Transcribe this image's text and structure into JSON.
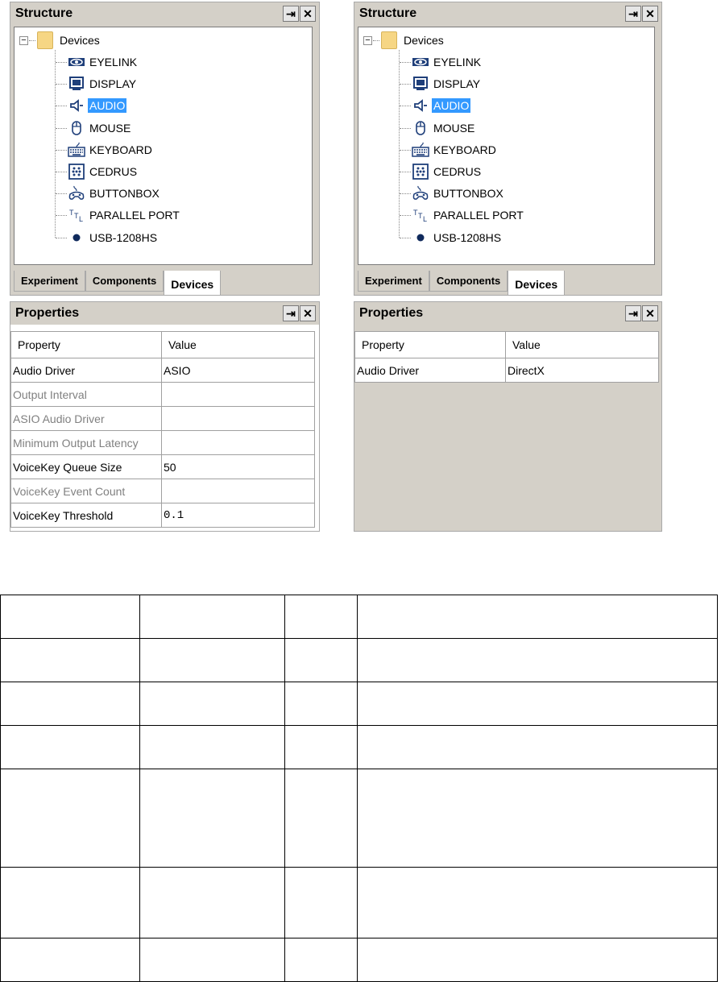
{
  "left": {
    "structure": {
      "title": "Structure",
      "root_label": "Devices",
      "items": [
        {
          "label": "EYELINK",
          "icon": "eyelink-icon"
        },
        {
          "label": "DISPLAY",
          "icon": "display-icon"
        },
        {
          "label": "AUDIO",
          "icon": "audio-icon",
          "selected": true
        },
        {
          "label": "MOUSE",
          "icon": "mouse-icon"
        },
        {
          "label": "KEYBOARD",
          "icon": "keyboard-icon"
        },
        {
          "label": "CEDRUS",
          "icon": "cedrus-icon"
        },
        {
          "label": "BUTTONBOX",
          "icon": "buttonbox-icon"
        },
        {
          "label": "PARALLEL PORT",
          "icon": "ttl-icon"
        },
        {
          "label": "USB-1208HS",
          "icon": "usb-dot-icon"
        }
      ],
      "tabs": [
        "Experiment",
        "Components",
        "Devices"
      ],
      "active_tab": "Devices"
    },
    "properties": {
      "title": "Properties",
      "header": {
        "property": "Property",
        "value": "Value"
      },
      "rows": [
        {
          "property": "Audio Driver",
          "value": "ASIO",
          "enabled": true
        },
        {
          "property": "Output Interval",
          "value": "",
          "enabled": false
        },
        {
          "property": "ASIO Audio Driver",
          "value": "",
          "enabled": false
        },
        {
          "property": "Minimum Output Latency",
          "value": "",
          "enabled": false
        },
        {
          "property": "VoiceKey Queue Size",
          "value": "50",
          "enabled": true
        },
        {
          "property": "VoiceKey Event Count",
          "value": "",
          "enabled": false
        },
        {
          "property": "VoiceKey Threshold",
          "value": "0.1",
          "enabled": true
        }
      ]
    }
  },
  "right": {
    "structure": {
      "title": "Structure",
      "root_label": "Devices",
      "items": [
        {
          "label": "EYELINK",
          "icon": "eyelink-icon"
        },
        {
          "label": "DISPLAY",
          "icon": "display-icon"
        },
        {
          "label": "AUDIO",
          "icon": "audio-icon",
          "selected": true
        },
        {
          "label": "MOUSE",
          "icon": "mouse-icon"
        },
        {
          "label": "KEYBOARD",
          "icon": "keyboard-icon"
        },
        {
          "label": "CEDRUS",
          "icon": "cedrus-icon"
        },
        {
          "label": "BUTTONBOX",
          "icon": "buttonbox-icon"
        },
        {
          "label": "PARALLEL PORT",
          "icon": "ttl-icon"
        },
        {
          "label": "USB-1208HS",
          "icon": "usb-dot-icon"
        }
      ],
      "tabs": [
        "Experiment",
        "Components",
        "Devices"
      ],
      "active_tab": "Devices"
    },
    "properties": {
      "title": "Properties",
      "header": {
        "property": "Property",
        "value": "Value"
      },
      "rows": [
        {
          "property": "Audio Driver",
          "value": "DirectX",
          "enabled": true
        }
      ]
    }
  },
  "pin_glyph": "⇥",
  "close_glyph": "✕",
  "selection_color": "#3399ff"
}
